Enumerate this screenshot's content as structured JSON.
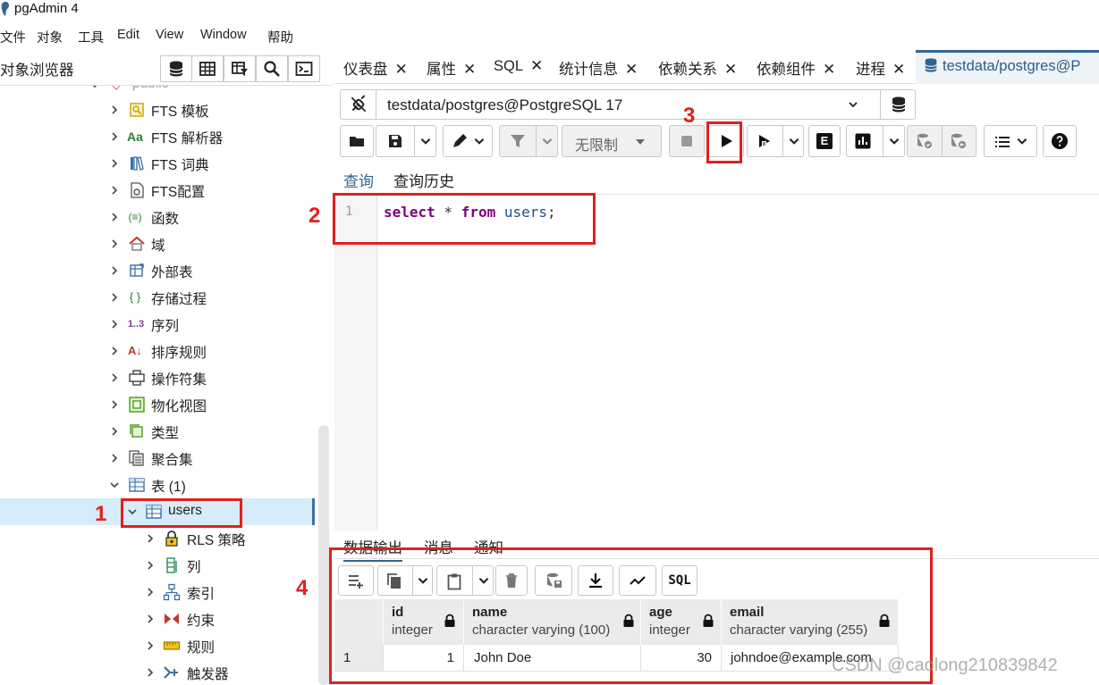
{
  "window": {
    "title": "pgAdmin 4"
  },
  "menu": [
    "文件",
    "对象",
    "工具",
    "Edit",
    "View",
    "Window",
    "帮助"
  ],
  "left_panel": {
    "title": "对象浏览器",
    "collapsed_parent": "public",
    "tree": [
      {
        "label": "FTS 模板",
        "icon": "fts-template-icon"
      },
      {
        "label": "FTS 解析器",
        "icon": "fts-parser-icon",
        "glyph": "Aa"
      },
      {
        "label": "FTS 词典",
        "icon": "fts-dictionary-icon"
      },
      {
        "label": "FTS配置",
        "icon": "fts-config-icon"
      },
      {
        "label": "函数",
        "icon": "function-icon",
        "glyph": "(≡)"
      },
      {
        "label": "域",
        "icon": "domain-icon"
      },
      {
        "label": "外部表",
        "icon": "foreign-table-icon"
      },
      {
        "label": "存储过程",
        "icon": "procedure-icon",
        "glyph": "{ }"
      },
      {
        "label": "序列",
        "icon": "sequence-icon",
        "glyph": "1..3"
      },
      {
        "label": "排序规则",
        "icon": "collation-icon",
        "glyph": "A↓"
      },
      {
        "label": "操作符集",
        "icon": "operator-icon"
      },
      {
        "label": "物化视图",
        "icon": "materialized-view-icon"
      },
      {
        "label": "类型",
        "icon": "type-icon"
      },
      {
        "label": "聚合集",
        "icon": "aggregate-icon"
      },
      {
        "label": "表 (1)",
        "icon": "table-icon"
      },
      {
        "label": "users",
        "icon": "table-icon"
      },
      {
        "label": "RLS 策略",
        "icon": "rls-policy-icon"
      },
      {
        "label": "列",
        "icon": "columns-icon"
      },
      {
        "label": "索引",
        "icon": "indexes-icon"
      },
      {
        "label": "约束",
        "icon": "constraints-icon"
      },
      {
        "label": "规则",
        "icon": "rules-icon"
      },
      {
        "label": "触发器",
        "icon": "triggers-icon"
      }
    ]
  },
  "tabs": [
    {
      "label": "仪表盘"
    },
    {
      "label": "属性"
    },
    {
      "label": "SQL"
    },
    {
      "label": "统计信息"
    },
    {
      "label": "依赖关系"
    },
    {
      "label": "依赖组件"
    },
    {
      "label": "进程"
    },
    {
      "label": "testdata/postgres@P"
    }
  ],
  "connection": {
    "label": "testdata/postgres@PostgreSQL 17"
  },
  "toolbar": {
    "limit_label": "无限制",
    "explain_label": "E",
    "sql_label": "SQL"
  },
  "query_tabs": [
    "查询",
    "查询历史"
  ],
  "editor": {
    "line_number": "1",
    "tokens": [
      "select",
      " * ",
      "from",
      " ",
      "users",
      ";"
    ]
  },
  "output_tabs": [
    "数据输出",
    "消息",
    "通知"
  ],
  "result_grid": {
    "columns": [
      {
        "name": "id",
        "type": "integer"
      },
      {
        "name": "name",
        "type": "character varying (100)"
      },
      {
        "name": "age",
        "type": "integer"
      },
      {
        "name": "email",
        "type": "character varying (255)"
      }
    ],
    "rows": [
      {
        "row_num": "1",
        "cells": [
          "1",
          "John Doe",
          "30",
          "johndoe@example.com"
        ]
      }
    ]
  },
  "annotations": [
    "1",
    "2",
    "3",
    "4"
  ],
  "watermark": "CSDN @caolong210839842",
  "colors": {
    "accent": "#326690",
    "annotation_red": "#e0201c",
    "selection": "#d6ecfa"
  }
}
